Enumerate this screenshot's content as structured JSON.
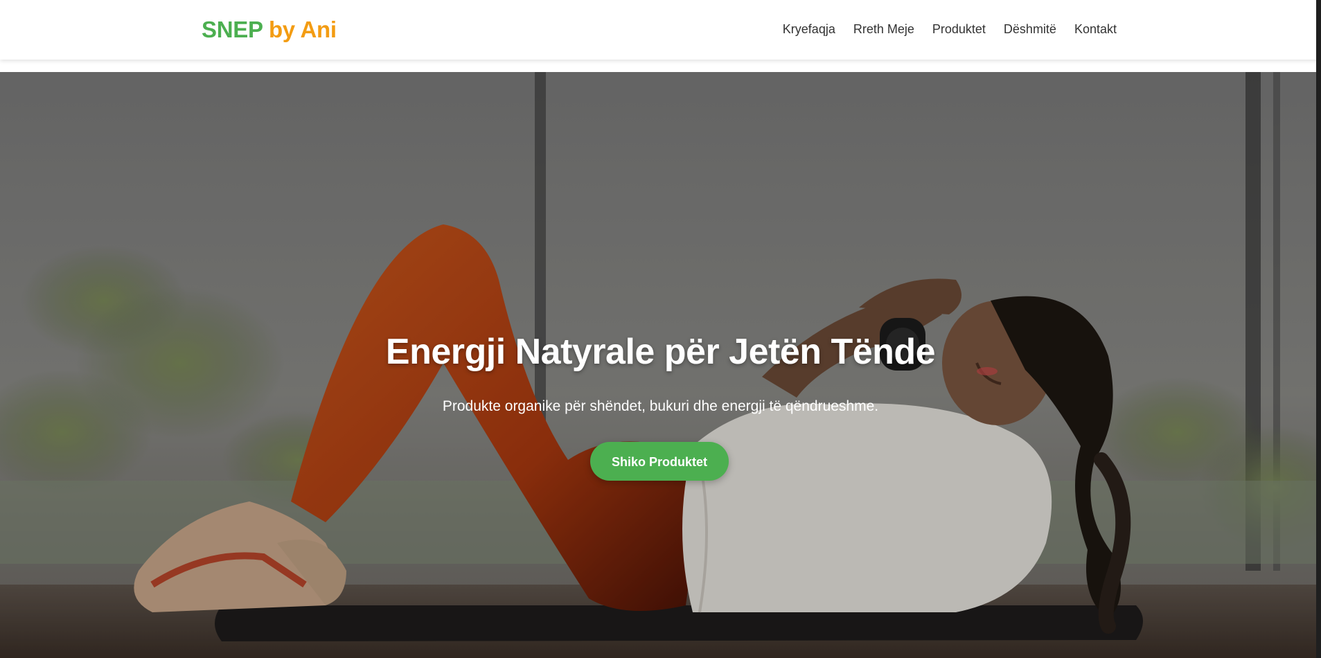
{
  "header": {
    "logo_part_1": "SNEP",
    "logo_part_2": "by Ani",
    "nav": [
      "Kryefaqja",
      "Rreth Meje",
      "Produktet",
      "Dëshmitë",
      "Kontakt"
    ]
  },
  "hero": {
    "title": "Energji Natyrale për Jetën Tënde",
    "subtitle": "Produkte organike për shëndet, bukuri dhe energji të qëndrueshme.",
    "cta_label": "Shiko Produktet"
  },
  "colors": {
    "brand_green": "#4caf50",
    "brand_orange": "#f39c12",
    "nav_text": "#333333",
    "hero_text": "#ffffff"
  }
}
